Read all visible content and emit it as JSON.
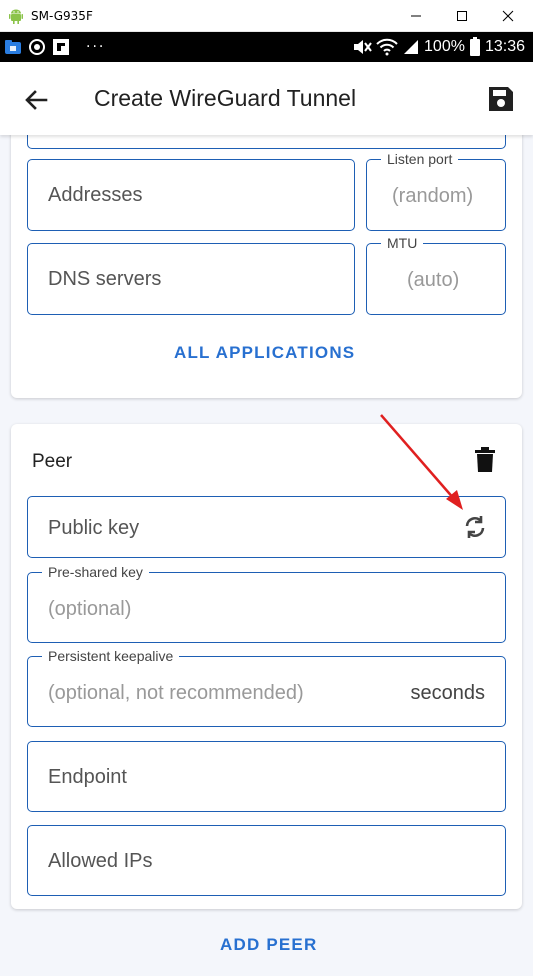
{
  "window": {
    "title": "SM-G935F"
  },
  "statusbar": {
    "battery": "100%",
    "time": "13:36",
    "more": "···"
  },
  "appbar": {
    "title": "Create WireGuard Tunnel"
  },
  "interface": {
    "addresses_placeholder": "Addresses",
    "listen_port_label": "Listen port",
    "listen_port_placeholder": "(random)",
    "dns_placeholder": "DNS servers",
    "mtu_label": "MTU",
    "mtu_placeholder": "(auto)",
    "all_applications_button": "ALL APPLICATIONS"
  },
  "peer": {
    "title": "Peer",
    "public_key_placeholder": "Public key",
    "preshared_key_label": "Pre-shared key",
    "preshared_key_placeholder": "(optional)",
    "keepalive_label": "Persistent keepalive",
    "keepalive_placeholder": "(optional, not recommended)",
    "keepalive_suffix": "seconds",
    "endpoint_placeholder": "Endpoint",
    "allowed_ips_placeholder": "Allowed IPs"
  },
  "add_peer_button": "ADD PEER",
  "colors": {
    "accent": "#2870d0",
    "field_border": "#1e5fb4",
    "annotation_arrow": "#e02020"
  }
}
